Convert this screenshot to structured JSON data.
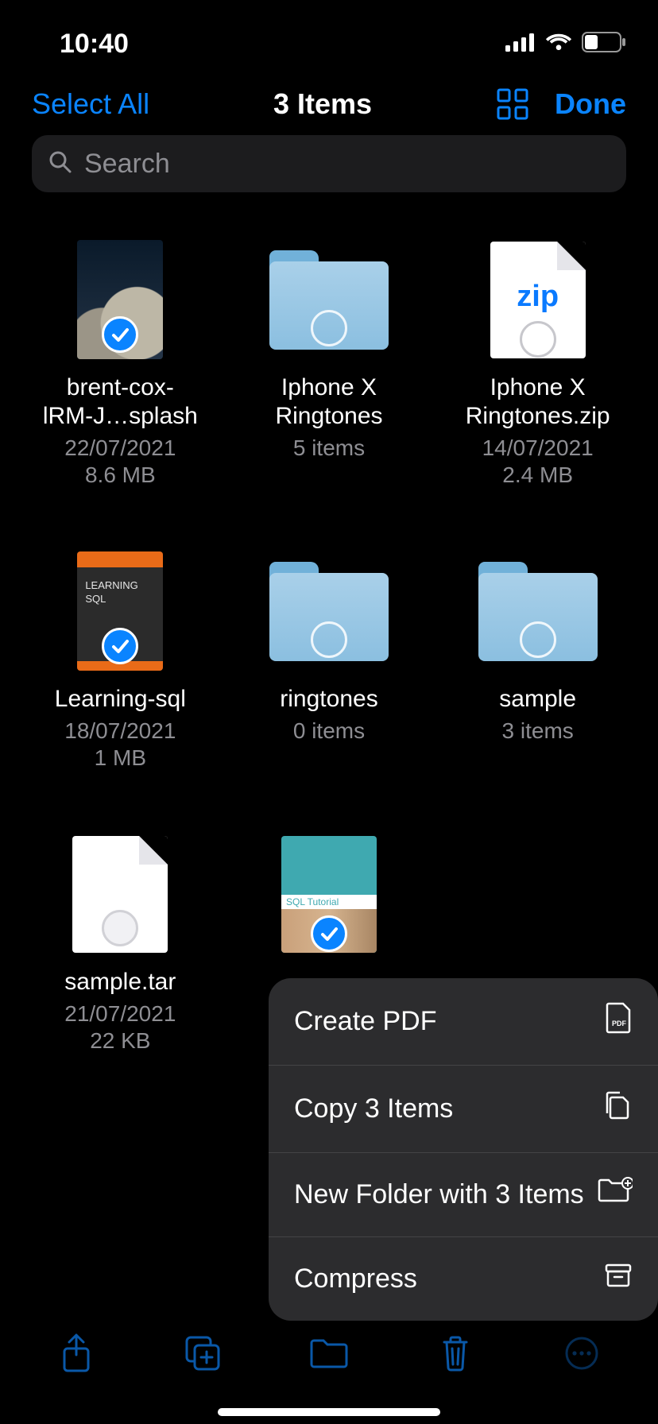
{
  "status": {
    "time": "10:40"
  },
  "nav": {
    "select_all": "Select All",
    "title": "3 Items",
    "done": "Done"
  },
  "search": {
    "placeholder": "Search"
  },
  "files": [
    {
      "name_line1": "brent-cox-",
      "name_line2": "lRM-J…splash",
      "date": "22/07/2021",
      "size": "8.6 MB"
    },
    {
      "name_line1": "Iphone X",
      "name_line2": "Ringtones",
      "meta": "5 items"
    },
    {
      "name_line1": "Iphone X",
      "name_line2": "Ringtones.zip",
      "date": "14/07/2021",
      "size": "2.4 MB",
      "zip_label": "zip"
    },
    {
      "name_line1": "Learning-sql",
      "date": "18/07/2021",
      "size": "1 MB",
      "book_label": "LEARNING\nSQL"
    },
    {
      "name_line1": "ringtones",
      "meta": "0 items"
    },
    {
      "name_line1": "sample",
      "meta": "3 items"
    },
    {
      "name_line1": "sample.tar",
      "date": "21/07/2021",
      "size": "22 KB"
    },
    {
      "name_line1": "",
      "tut_label": "SQL Tutorial"
    }
  ],
  "menu": {
    "create_pdf": "Create PDF",
    "copy": "Copy 3 Items",
    "new_folder": "New Folder with 3 Items",
    "compress": "Compress"
  }
}
